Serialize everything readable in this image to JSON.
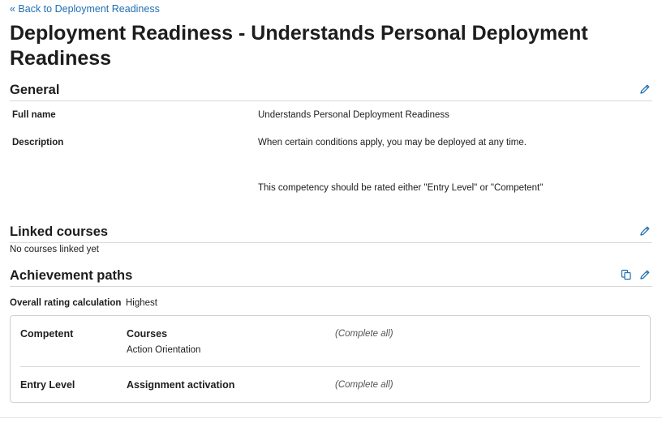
{
  "nav": {
    "back_link": "« Back to Deployment Readiness"
  },
  "page": {
    "title": "Deployment Readiness - Understands Personal Deployment Readiness"
  },
  "general": {
    "heading": "General",
    "full_name_label": "Full name",
    "full_name_value": "Understands Personal Deployment Readiness",
    "description_label": "Description",
    "description_line1": "When certain conditions apply, you may be deployed at any time.",
    "description_line2": "This competency should be rated either \"Entry Level\" or \"Competent\""
  },
  "linked_courses": {
    "heading": "Linked courses",
    "empty_text": "No courses linked yet"
  },
  "achievement_paths": {
    "heading": "Achievement paths",
    "overall_label": "Overall rating calculation",
    "overall_value": "Highest",
    "paths": [
      {
        "level": "Competent",
        "type": "Courses",
        "note": "(Complete all)",
        "items": [
          "Action Orientation"
        ]
      },
      {
        "level": "Entry Level",
        "type": "Assignment activation",
        "note": "(Complete all)",
        "items": []
      }
    ]
  },
  "icons": {
    "edit": "pencil-icon",
    "copy": "copy-icon"
  },
  "colors": {
    "link": "#1f6fb2",
    "text": "#1d1d1d",
    "border": "#d8d8d8"
  }
}
